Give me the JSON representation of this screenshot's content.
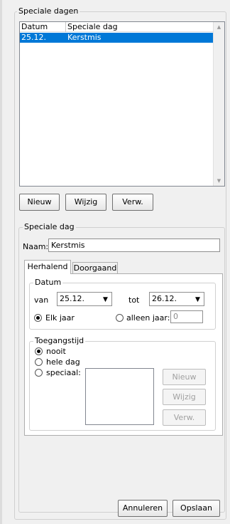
{
  "special_days": {
    "group_label": "Speciale dagen",
    "columns": [
      "Datum",
      "Speciale dag"
    ],
    "rows": [
      {
        "date": "25.12.",
        "name": "Kerstmis",
        "selected": true
      }
    ],
    "buttons": {
      "new": "Nieuw",
      "edit": "Wijzig",
      "delete": "Verw."
    }
  },
  "special_day": {
    "group_label": "Speciale dag",
    "name_label": "Naam:",
    "name_value": "Kerstmis",
    "tabs": [
      "Herhalend",
      "Doorgaand"
    ],
    "active_tab": "Herhalend",
    "date": {
      "group_label": "Datum",
      "from_label": "van",
      "from_value": "25.12.",
      "to_label": "tot",
      "to_value": "26.12.",
      "every_year_label": "Elk jaar",
      "only_year_label": "alleen jaar:",
      "only_year_value": "0",
      "selected": "every_year"
    },
    "access": {
      "group_label": "Toegangstijd",
      "options": [
        "nooit",
        "hele dag",
        "speciaal:"
      ],
      "selected": "nooit",
      "buttons": {
        "new": "Nieuw",
        "edit": "Wijzig",
        "delete": "Verw."
      }
    }
  },
  "footer": {
    "cancel": "Annuleren",
    "save": "Opslaan"
  },
  "colors": {
    "selection": "#0078d7",
    "background": "#f0f0f0",
    "group_border": "#d0d0d0"
  }
}
